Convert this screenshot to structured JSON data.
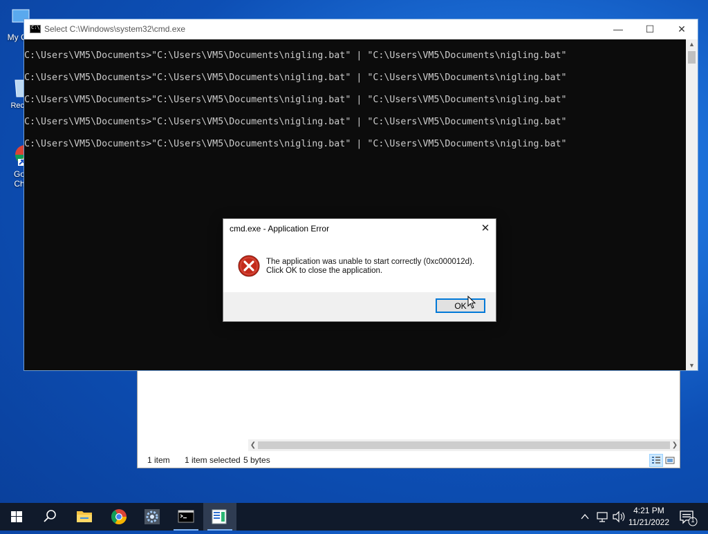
{
  "desktop": {
    "icons": [
      {
        "label": "My Co"
      },
      {
        "label": "Recy"
      },
      {
        "label": "Go\nCh"
      }
    ]
  },
  "cmd_window": {
    "title": "Select C:\\Windows\\system32\\cmd.exe",
    "lines": [
      "C:\\Users\\VM5\\Documents>\"C:\\Users\\VM5\\Documents\\nigling.bat\" | \"C:\\Users\\VM5\\Documents\\nigling.bat\"",
      "C:\\Users\\VM5\\Documents>\"C:\\Users\\VM5\\Documents\\nigling.bat\" | \"C:\\Users\\VM5\\Documents\\nigling.bat\"",
      "C:\\Users\\VM5\\Documents>\"C:\\Users\\VM5\\Documents\\nigling.bat\" | \"C:\\Users\\VM5\\Documents\\nigling.bat\"",
      "C:\\Users\\VM5\\Documents>\"C:\\Users\\VM5\\Documents\\nigling.bat\" | \"C:\\Users\\VM5\\Documents\\nigling.bat\"",
      "C:\\Users\\VM5\\Documents>\"C:\\Users\\VM5\\Documents\\nigling.bat\" | \"C:\\Users\\VM5\\Documents\\nigling.bat\""
    ]
  },
  "error_dialog": {
    "title": "cmd.exe - Application Error",
    "message_line1": "The application was unable to start correctly (0xc000012d).",
    "message_line2": "Click OK to close the application.",
    "ok_label": "OK",
    "icon": "error-icon"
  },
  "explorer": {
    "status_items": "1 item",
    "status_selected": "1 item selected",
    "status_size": "5 bytes"
  },
  "taskbar": {
    "items": [
      "start-icon",
      "search-icon",
      "file-explorer-icon",
      "chrome-icon",
      "settings-app-icon",
      "cmd-icon",
      "notepad-icon"
    ],
    "clock_time": "4:21 PM",
    "clock_date": "11/21/2022",
    "notification_count": "1"
  },
  "colors": {
    "accent": "#0078d7",
    "console_bg": "#0c0c0c",
    "console_fg": "#cccccc",
    "error_red": "#c42b1c"
  }
}
